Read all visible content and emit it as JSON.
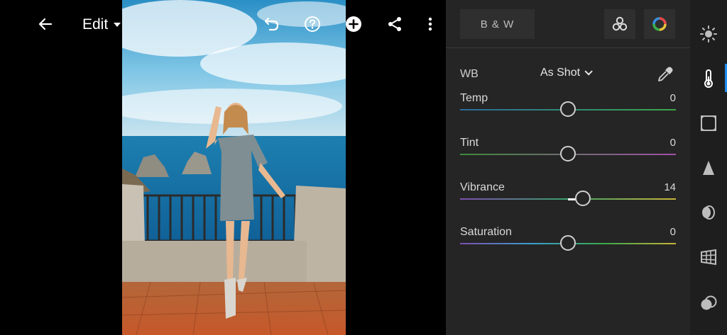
{
  "toolbar": {
    "edit_label": "Edit"
  },
  "panel": {
    "bw_label": "B & W",
    "wb": {
      "label": "WB",
      "value": "As Shot"
    },
    "sliders": [
      {
        "label": "Temp",
        "value": "0",
        "position": 0.5,
        "gradient": [
          "#2a6a9e",
          "#3aa84a"
        ]
      },
      {
        "label": "Tint",
        "value": "0",
        "position": 0.5,
        "gradient": [
          "#3f8a3a",
          "#a04fa8"
        ]
      },
      {
        "label": "Vibrance",
        "value": "14",
        "position": 0.57,
        "gradient": [
          "#7d4fb0",
          "#3aa06a",
          "#c9b53a"
        ]
      },
      {
        "label": "Saturation",
        "value": "0",
        "position": 0.5,
        "gradient": [
          "#7d4fb0",
          "#3a9fd0",
          "#3aa84a",
          "#c9b53a"
        ]
      }
    ]
  },
  "rail": {
    "items": [
      "light-icon",
      "color-icon",
      "effects-icon",
      "detail-icon",
      "optics-icon",
      "geometry-icon",
      "mask-icon"
    ],
    "active_index": 1
  },
  "colors": {
    "panel_bg": "#252525",
    "rail_bg": "#1e1e1e",
    "accent": "#1d8cf0"
  }
}
